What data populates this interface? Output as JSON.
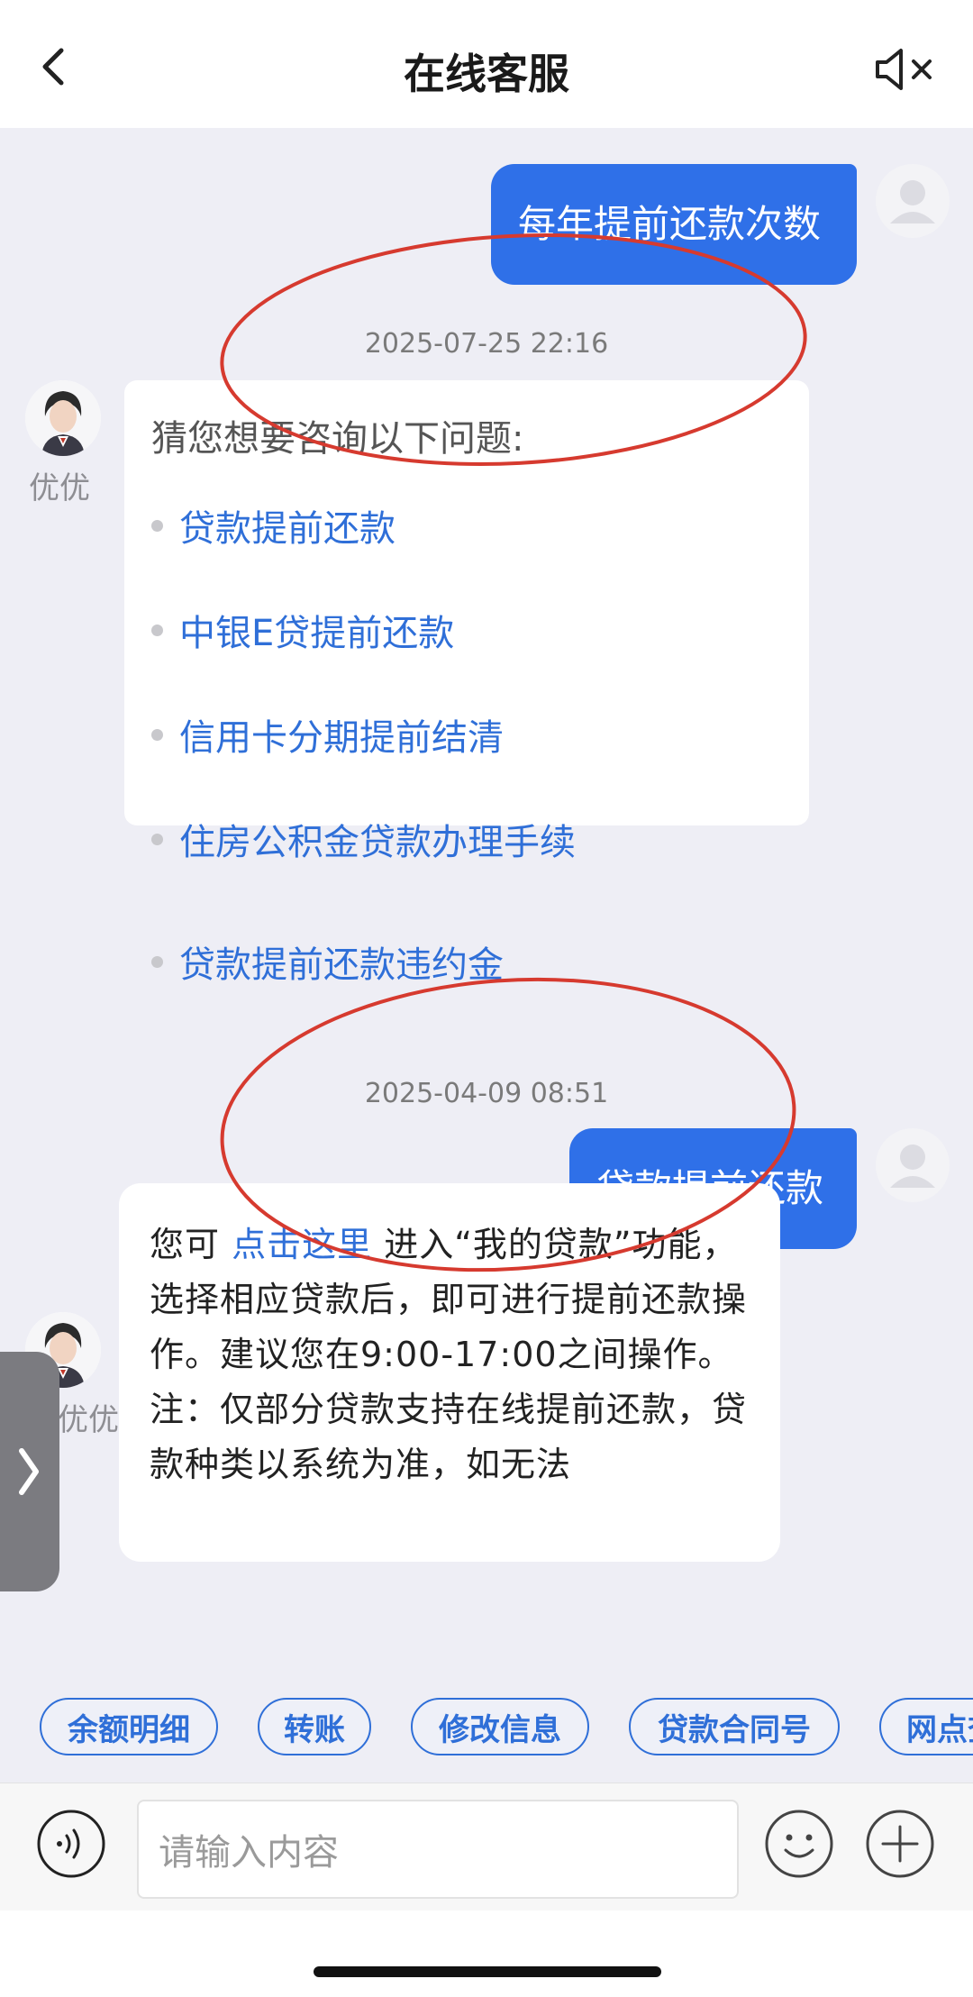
{
  "header": {
    "title": "在线客服",
    "back_icon": "chevron-left-icon",
    "sound_icon": "speaker-muted-icon"
  },
  "messages": {
    "user_1": "每年提前还款次数",
    "timestamp_1": "2025-07-25 22:16",
    "bot_name": "优优",
    "card_question": "猜您想要咨询以下问题:",
    "options": [
      "贷款提前还款",
      "中银E贷提前还款",
      "信用卡分期提前结清",
      "住房公积金贷款办理手续",
      "贷款提前还款违约金"
    ],
    "timestamp_2": "2025-04-09 08:51",
    "user_2": "贷款提前还款",
    "answer": {
      "prefix": "您可 ",
      "link": "点击这里",
      "text_1": " 进入“我的贷款”功能，选择相应贷款后，即可进行提前还款操作。建议您在9:00-17:00之间操作。",
      "text_2": "注：仅部分贷款支持在线提前还款，贷款种类以系统为准，如无法"
    }
  },
  "side_tab": {
    "icon": "chevron-right-icon",
    "label": "〉"
  },
  "chips": [
    "余额明细",
    "转账",
    "修改信息",
    "贷款合同号",
    "网点查询"
  ],
  "input": {
    "placeholder": "请输入内容"
  },
  "colors": {
    "accent": "#2f70e8",
    "link": "#2f6fd8",
    "annotation": "#d63a2f",
    "background": "#eeeef5"
  }
}
